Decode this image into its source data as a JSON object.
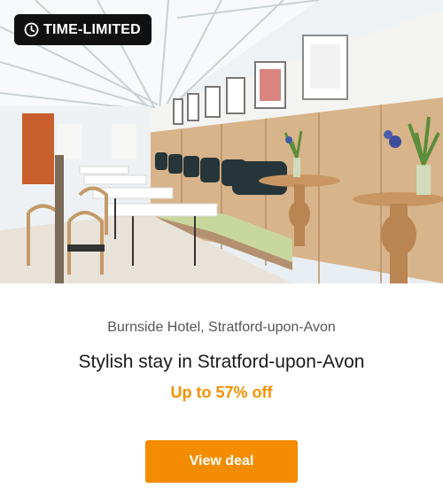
{
  "badge": {
    "label": "TIME-LIMITED",
    "icon": "clock-icon"
  },
  "hotel": {
    "name_location": "Burnside Hotel, Stratford-upon-Avon"
  },
  "deal": {
    "title": "Stylish stay in Stratford-upon-Avon",
    "discount": "Up to 57% off",
    "cta_label": "View deal"
  },
  "colors": {
    "accent": "#f38c00",
    "badge_bg": "#111111"
  }
}
